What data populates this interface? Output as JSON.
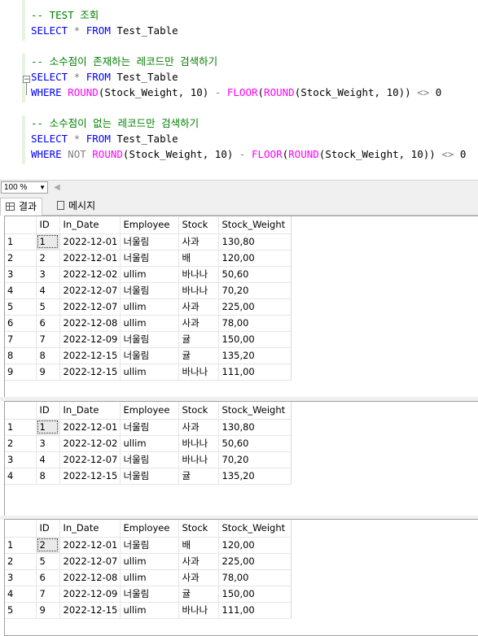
{
  "editor": {
    "lines": [
      [
        {
          "t": "-- TEST 조회",
          "c": "cm"
        }
      ],
      [
        {
          "t": "SELECT",
          "c": "kw"
        },
        {
          "t": " ",
          "c": ""
        },
        {
          "t": "*",
          "c": "op"
        },
        {
          "t": " ",
          "c": ""
        },
        {
          "t": "FROM",
          "c": "kw"
        },
        {
          "t": " Test_Table",
          "c": ""
        }
      ],
      [],
      [
        {
          "t": "-- 소수점이 존재하는 레코드만 검색하기",
          "c": "cm"
        }
      ],
      [
        {
          "t": "SELECT",
          "c": "kw"
        },
        {
          "t": " ",
          "c": ""
        },
        {
          "t": "*",
          "c": "op"
        },
        {
          "t": " ",
          "c": ""
        },
        {
          "t": "FROM",
          "c": "kw"
        },
        {
          "t": " Test_Table",
          "c": ""
        }
      ],
      [
        {
          "t": "WHERE",
          "c": "kw"
        },
        {
          "t": " ",
          "c": ""
        },
        {
          "t": "ROUND",
          "c": "fn"
        },
        {
          "t": "(Stock_Weight, 10) ",
          "c": ""
        },
        {
          "t": "-",
          "c": "op"
        },
        {
          "t": " ",
          "c": ""
        },
        {
          "t": "FLOOR",
          "c": "fn"
        },
        {
          "t": "(",
          "c": ""
        },
        {
          "t": "ROUND",
          "c": "fn"
        },
        {
          "t": "(Stock_Weight, 10)) ",
          "c": ""
        },
        {
          "t": "<>",
          "c": "op"
        },
        {
          "t": " 0",
          "c": ""
        }
      ],
      [],
      [
        {
          "t": "-- 소수점이 없는 레코드만 검색하기",
          "c": "cm"
        }
      ],
      [
        {
          "t": "SELECT",
          "c": "kw"
        },
        {
          "t": " ",
          "c": ""
        },
        {
          "t": "*",
          "c": "op"
        },
        {
          "t": " ",
          "c": ""
        },
        {
          "t": "FROM",
          "c": "kw"
        },
        {
          "t": " Test_Table",
          "c": ""
        }
      ],
      [
        {
          "t": "WHERE",
          "c": "kw"
        },
        {
          "t": " ",
          "c": ""
        },
        {
          "t": "NOT",
          "c": "op"
        },
        {
          "t": " ",
          "c": ""
        },
        {
          "t": "ROUND",
          "c": "fn"
        },
        {
          "t": "(Stock_Weight, 10) ",
          "c": ""
        },
        {
          "t": "-",
          "c": "op"
        },
        {
          "t": " ",
          "c": ""
        },
        {
          "t": "FLOOR",
          "c": "fn"
        },
        {
          "t": "(",
          "c": ""
        },
        {
          "t": "ROUND",
          "c": "fn"
        },
        {
          "t": "(Stock_Weight, 10)) ",
          "c": ""
        },
        {
          "t": "<>",
          "c": "op"
        },
        {
          "t": " 0",
          "c": ""
        }
      ]
    ]
  },
  "zoom": {
    "value": "100 %"
  },
  "tabs": {
    "results": "결과",
    "messages": "메시지"
  },
  "columns": [
    "ID",
    "In_Date",
    "Employee",
    "Stock",
    "Stock_Weight"
  ],
  "results": [
    {
      "rows": [
        [
          "1",
          "1",
          "2022-12-01",
          "너울림",
          "사과",
          "130,80"
        ],
        [
          "2",
          "2",
          "2022-12-01",
          "너울림",
          "배",
          "120,00"
        ],
        [
          "3",
          "3",
          "2022-12-02",
          "ullim",
          "바나나",
          "50,60"
        ],
        [
          "4",
          "4",
          "2022-12-07",
          "너울림",
          "바나나",
          "70,20"
        ],
        [
          "5",
          "5",
          "2022-12-07",
          "ullim",
          "사과",
          "225,00"
        ],
        [
          "6",
          "6",
          "2022-12-08",
          "ullim",
          "사과",
          "78,00"
        ],
        [
          "7",
          "7",
          "2022-12-09",
          "너울림",
          "귤",
          "150,00"
        ],
        [
          "8",
          "8",
          "2022-12-15",
          "너울림",
          "귤",
          "135,20"
        ],
        [
          "9",
          "9",
          "2022-12-15",
          "ullim",
          "바나나",
          "111,00"
        ]
      ]
    },
    {
      "rows": [
        [
          "1",
          "1",
          "2022-12-01",
          "너울림",
          "사과",
          "130,80"
        ],
        [
          "2",
          "3",
          "2022-12-02",
          "ullim",
          "바나나",
          "50,60"
        ],
        [
          "3",
          "4",
          "2022-12-07",
          "너울림",
          "바나나",
          "70,20"
        ],
        [
          "4",
          "8",
          "2022-12-15",
          "너울림",
          "귤",
          "135,20"
        ]
      ]
    },
    {
      "rows": [
        [
          "1",
          "2",
          "2022-12-01",
          "너울림",
          "배",
          "120,00"
        ],
        [
          "2",
          "5",
          "2022-12-07",
          "ullim",
          "사과",
          "225,00"
        ],
        [
          "3",
          "6",
          "2022-12-08",
          "ullim",
          "사과",
          "78,00"
        ],
        [
          "4",
          "7",
          "2022-12-09",
          "너울림",
          "귤",
          "150,00"
        ],
        [
          "5",
          "9",
          "2022-12-15",
          "ullim",
          "바나나",
          "111,00"
        ]
      ]
    }
  ]
}
